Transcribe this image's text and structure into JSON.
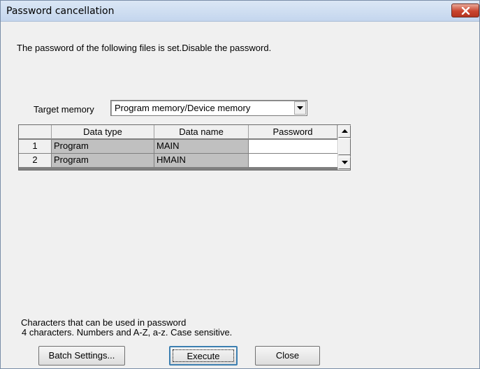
{
  "window": {
    "title": "Password cancellation"
  },
  "message": "The password of the following files is set.Disable the password.",
  "target_memory": {
    "label": "Target memory",
    "value": "Program memory/Device memory"
  },
  "table": {
    "headers": [
      "",
      "Data type",
      "Data name",
      "Password"
    ],
    "rows": [
      {
        "num": "1",
        "data_type": "Program",
        "data_name": "MAIN",
        "password": ""
      },
      {
        "num": "2",
        "data_type": "Program",
        "data_name": "HMAIN",
        "password": ""
      }
    ]
  },
  "hint": {
    "line1": "Characters that can be used in password",
    "line2": "4 characters. Numbers and A-Z, a-z. Case sensitive."
  },
  "buttons": {
    "batch": "Batch Settings...",
    "execute": "Execute",
    "close": "Close"
  },
  "colors": {
    "titlebar": "#c4d6ee",
    "close_button": "#c9452f",
    "dialog_bg": "#f0f0f0",
    "readonly_cell": "#c0c0c0",
    "default_button_border": "#3c7fb1"
  }
}
